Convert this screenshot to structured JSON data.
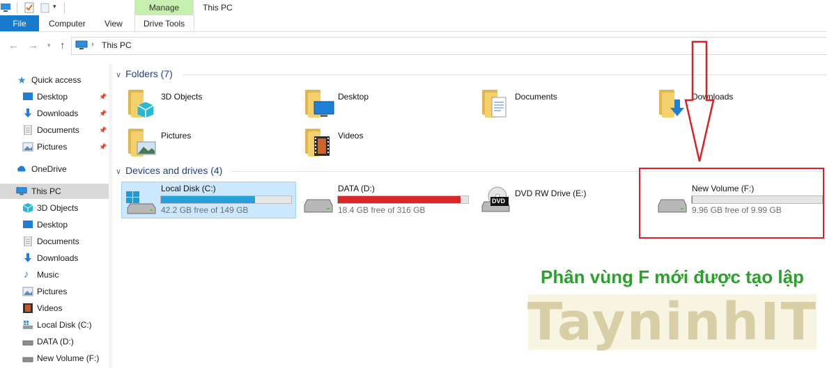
{
  "window": {
    "title": "This PC"
  },
  "ribbon": {
    "file": "File",
    "tabs": [
      "Computer",
      "View"
    ],
    "manage": "Manage",
    "drive_tools": "Drive Tools"
  },
  "address": {
    "path": "This PC"
  },
  "sidebar": {
    "quick_access": "Quick access",
    "qa_items": [
      {
        "label": "Desktop",
        "icon": "desktop-icon"
      },
      {
        "label": "Downloads",
        "icon": "download-icon"
      },
      {
        "label": "Documents",
        "icon": "document-icon"
      },
      {
        "label": "Pictures",
        "icon": "pictures-icon"
      }
    ],
    "onedrive": "OneDrive",
    "this_pc": "This PC",
    "pc_items": [
      {
        "label": "3D Objects",
        "icon": "3d-objects-icon"
      },
      {
        "label": "Desktop",
        "icon": "desktop-icon"
      },
      {
        "label": "Documents",
        "icon": "document-icon"
      },
      {
        "label": "Downloads",
        "icon": "download-icon"
      },
      {
        "label": "Music",
        "icon": "music-icon"
      },
      {
        "label": "Pictures",
        "icon": "pictures-icon"
      },
      {
        "label": "Videos",
        "icon": "videos-icon"
      },
      {
        "label": "Local Disk (C:)",
        "icon": "drive-icon"
      },
      {
        "label": "DATA (D:)",
        "icon": "drive-icon"
      },
      {
        "label": "New Volume (F:)",
        "icon": "drive-icon"
      }
    ]
  },
  "folders": {
    "header": "Folders (7)",
    "items": [
      {
        "label": "3D Objects"
      },
      {
        "label": "Desktop"
      },
      {
        "label": "Documents"
      },
      {
        "label": "Downloads"
      },
      {
        "label": "Pictures"
      },
      {
        "label": "Videos"
      }
    ]
  },
  "drives": {
    "header": "Devices and drives (4)",
    "items": [
      {
        "label": "Local Disk (C:)",
        "free": "42.2 GB free of 149 GB",
        "used_fraction": 0.72,
        "bar_color": "#26a0da"
      },
      {
        "label": "DATA (D:)",
        "free": "18.4 GB free of 316 GB",
        "used_fraction": 0.94,
        "bar_color": "#da2626"
      },
      {
        "label": "DVD RW Drive (E:)",
        "dvd_label": "DVD"
      },
      {
        "label": "New Volume (F:)",
        "free": "9.96 GB free of 9.99 GB",
        "used_fraction": 0.003,
        "bar_color": "#26a0da"
      }
    ]
  },
  "annotation": {
    "text": "Phân vùng F mới được tạo lập",
    "color": "#2aa12a",
    "box_color": "#e02020"
  },
  "watermark": {
    "text": "TayninhIT"
  }
}
